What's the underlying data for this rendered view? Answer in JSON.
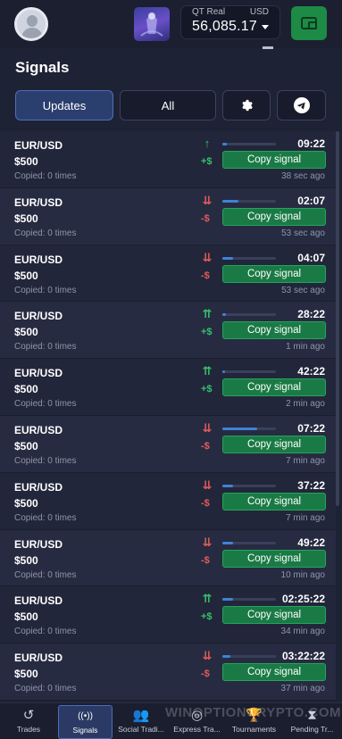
{
  "header": {
    "account_type": "QT Real",
    "currency": "USD",
    "balance": "56,085.17"
  },
  "page": {
    "title": "Signals"
  },
  "filters": {
    "updates": "Updates",
    "all": "All"
  },
  "signals": [
    {
      "pair": "EUR/USD",
      "amount": "$500",
      "copied": "Copied: 0 times",
      "arrow": "↑",
      "direction": "up",
      "sign": "+$",
      "progress": 0.08,
      "timer": "09:22",
      "copy": "Copy signal",
      "ago": "38 sec ago"
    },
    {
      "pair": "EUR/USD",
      "amount": "$500",
      "copied": "Copied: 0 times",
      "arrow": "⇊",
      "direction": "down",
      "sign": "-$",
      "progress": 0.3,
      "timer": "02:07",
      "copy": "Copy signal",
      "ago": "53 sec ago"
    },
    {
      "pair": "EUR/USD",
      "amount": "$500",
      "copied": "Copied: 0 times",
      "arrow": "⇊",
      "direction": "down",
      "sign": "-$",
      "progress": 0.2,
      "timer": "04:07",
      "copy": "Copy signal",
      "ago": "53 sec ago"
    },
    {
      "pair": "EUR/USD",
      "amount": "$500",
      "copied": "Copied: 0 times",
      "arrow": "⇈",
      "direction": "up",
      "sign": "+$",
      "progress": 0.06,
      "timer": "28:22",
      "copy": "Copy signal",
      "ago": "1 min ago"
    },
    {
      "pair": "EUR/USD",
      "amount": "$500",
      "copied": "Copied: 0 times",
      "arrow": "⇈",
      "direction": "up",
      "sign": "+$",
      "progress": 0.05,
      "timer": "42:22",
      "copy": "Copy signal",
      "ago": "2 min ago"
    },
    {
      "pair": "EUR/USD",
      "amount": "$500",
      "copied": "Copied: 0 times",
      "arrow": "⇊",
      "direction": "down",
      "sign": "-$",
      "progress": 0.65,
      "timer": "07:22",
      "copy": "Copy signal",
      "ago": "7 min ago"
    },
    {
      "pair": "EUR/USD",
      "amount": "$500",
      "copied": "Copied: 0 times",
      "arrow": "⇊",
      "direction": "down",
      "sign": "-$",
      "progress": 0.2,
      "timer": "37:22",
      "copy": "Copy signal",
      "ago": "7 min ago"
    },
    {
      "pair": "EUR/USD",
      "amount": "$500",
      "copied": "Copied: 0 times",
      "arrow": "⇊",
      "direction": "down",
      "sign": "-$",
      "progress": 0.2,
      "timer": "49:22",
      "copy": "Copy signal",
      "ago": "10 min ago"
    },
    {
      "pair": "EUR/USD",
      "amount": "$500",
      "copied": "Copied: 0 times",
      "arrow": "⇈",
      "direction": "up",
      "sign": "+$",
      "progress": 0.2,
      "timer": "02:25:22",
      "copy": "Copy signal",
      "ago": "34 min ago"
    },
    {
      "pair": "EUR/USD",
      "amount": "$500",
      "copied": "Copied: 0 times",
      "arrow": "⇊",
      "direction": "down",
      "sign": "-$",
      "progress": 0.15,
      "timer": "03:22:22",
      "copy": "Copy signal",
      "ago": "37 min ago"
    }
  ],
  "nav": [
    {
      "label": "Trades",
      "icon": "history-icon"
    },
    {
      "label": "Signals",
      "icon": "signal-antenna-icon"
    },
    {
      "label": "Social Tradi...",
      "icon": "users-icon"
    },
    {
      "label": "Express Tra...",
      "icon": "target-icon"
    },
    {
      "label": "Tournaments",
      "icon": "trophy-icon"
    },
    {
      "label": "Pending Tr...",
      "icon": "hourglass-icon"
    }
  ],
  "watermark": "WINOPTIONCRYPTO.COM",
  "colors": {
    "up": "#35c16b",
    "down": "#e25b5b",
    "copy_button": "#1a7a45",
    "active_filter": "#2b3f6e",
    "wallet": "#1d8a45"
  }
}
